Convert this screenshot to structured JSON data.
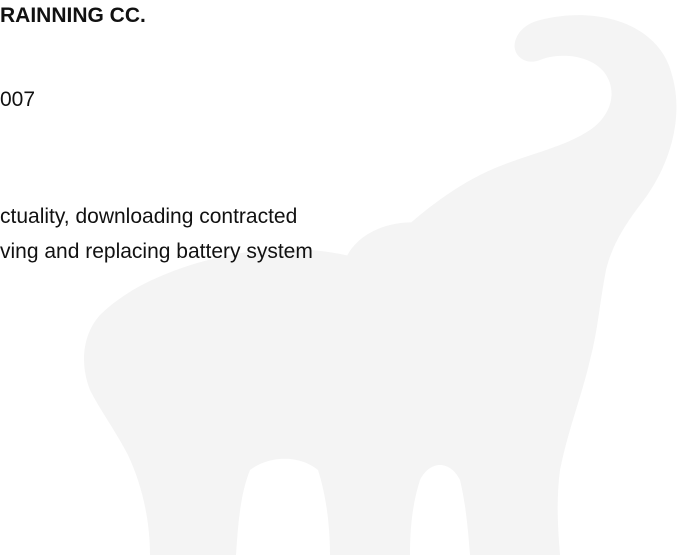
{
  "document": {
    "heading": "RAINNING CC.",
    "year_fragment": "007",
    "description_lines": [
      "ctuality, downloading contracted",
      "ving and replacing battery system"
    ]
  },
  "watermark": {
    "icon": "elephant-icon",
    "color": "#f4f4f4"
  }
}
